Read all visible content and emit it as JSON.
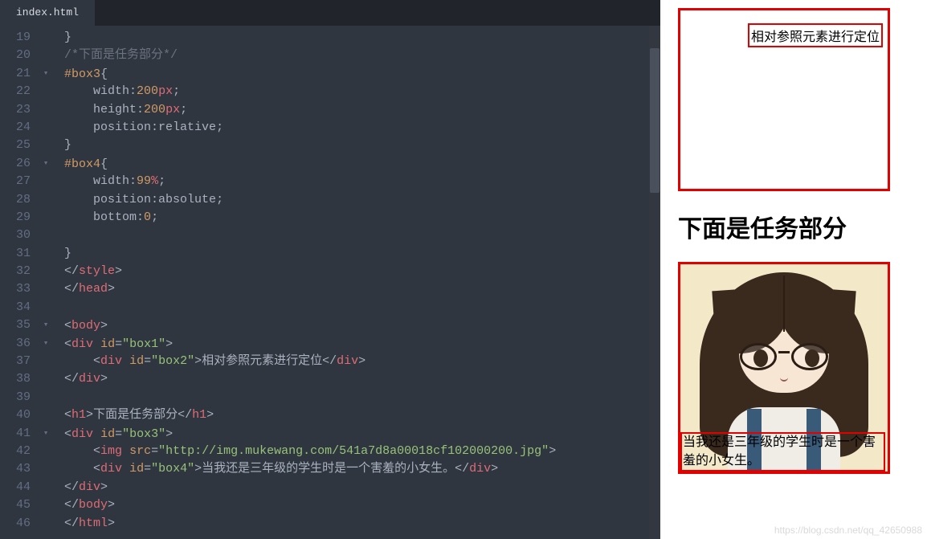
{
  "editor": {
    "tab": "index.html",
    "first_line_number": 19,
    "lines": [
      {
        "n": 19,
        "fold": "",
        "seg": [
          [
            "  ",
            "p"
          ],
          [
            "}",
            "p"
          ]
        ]
      },
      {
        "n": 20,
        "fold": "",
        "seg": [
          [
            "  ",
            "p"
          ],
          [
            "/*下面是任务部分*/",
            "comment"
          ]
        ]
      },
      {
        "n": 21,
        "fold": "v",
        "seg": [
          [
            "  ",
            "p"
          ],
          [
            "#box3",
            "sel"
          ],
          [
            "{",
            "p"
          ]
        ]
      },
      {
        "n": 22,
        "fold": "",
        "seg": [
          [
            "      ",
            "p"
          ],
          [
            "width",
            "prop"
          ],
          [
            ":",
            "p"
          ],
          [
            "200",
            "num"
          ],
          [
            "px",
            "unit"
          ],
          [
            ";",
            "p"
          ]
        ]
      },
      {
        "n": 23,
        "fold": "",
        "seg": [
          [
            "      ",
            "p"
          ],
          [
            "height",
            "prop"
          ],
          [
            ":",
            "p"
          ],
          [
            "200",
            "num"
          ],
          [
            "px",
            "unit"
          ],
          [
            ";",
            "p"
          ]
        ]
      },
      {
        "n": 24,
        "fold": "",
        "seg": [
          [
            "      ",
            "p"
          ],
          [
            "position",
            "prop"
          ],
          [
            ":",
            "p"
          ],
          [
            "relative",
            "val"
          ],
          [
            ";",
            "p"
          ]
        ]
      },
      {
        "n": 25,
        "fold": "",
        "seg": [
          [
            "  ",
            "p"
          ],
          [
            "}",
            "p"
          ]
        ]
      },
      {
        "n": 26,
        "fold": "v",
        "seg": [
          [
            "  ",
            "p"
          ],
          [
            "#box4",
            "sel"
          ],
          [
            "{",
            "p"
          ]
        ]
      },
      {
        "n": 27,
        "fold": "",
        "seg": [
          [
            "      ",
            "p"
          ],
          [
            "width",
            "prop"
          ],
          [
            ":",
            "p"
          ],
          [
            "99",
            "num"
          ],
          [
            "%",
            "unit"
          ],
          [
            ";",
            "p"
          ]
        ]
      },
      {
        "n": 28,
        "fold": "",
        "seg": [
          [
            "      ",
            "p"
          ],
          [
            "position",
            "prop"
          ],
          [
            ":",
            "p"
          ],
          [
            "absolute",
            "val"
          ],
          [
            ";",
            "p"
          ]
        ]
      },
      {
        "n": 29,
        "fold": "",
        "seg": [
          [
            "      ",
            "p"
          ],
          [
            "bottom",
            "prop"
          ],
          [
            ":",
            "p"
          ],
          [
            "0",
            "num"
          ],
          [
            ";",
            "p"
          ]
        ]
      },
      {
        "n": 30,
        "fold": "",
        "seg": [
          [
            "",
            "p"
          ]
        ]
      },
      {
        "n": 31,
        "fold": "",
        "seg": [
          [
            "  ",
            "p"
          ],
          [
            "}",
            "p"
          ]
        ]
      },
      {
        "n": 32,
        "fold": "",
        "seg": [
          [
            "  ",
            "p"
          ],
          [
            "</",
            "p"
          ],
          [
            "style",
            "tag"
          ],
          [
            ">",
            "p"
          ]
        ]
      },
      {
        "n": 33,
        "fold": "",
        "seg": [
          [
            "  ",
            "p"
          ],
          [
            "</",
            "p"
          ],
          [
            "head",
            "tag"
          ],
          [
            ">",
            "p"
          ]
        ]
      },
      {
        "n": 34,
        "fold": "",
        "seg": [
          [
            "",
            "p"
          ]
        ]
      },
      {
        "n": 35,
        "fold": "v",
        "seg": [
          [
            "  ",
            "p"
          ],
          [
            "<",
            "p"
          ],
          [
            "body",
            "tag"
          ],
          [
            ">",
            "p"
          ]
        ]
      },
      {
        "n": 36,
        "fold": "v",
        "seg": [
          [
            "  ",
            "p"
          ],
          [
            "<",
            "p"
          ],
          [
            "div",
            "tag"
          ],
          [
            " ",
            "p"
          ],
          [
            "id",
            "attr"
          ],
          [
            "=",
            "p"
          ],
          [
            "\"box1\"",
            "str"
          ],
          [
            ">",
            "p"
          ]
        ]
      },
      {
        "n": 37,
        "fold": "",
        "seg": [
          [
            "      ",
            "p"
          ],
          [
            "<",
            "p"
          ],
          [
            "div",
            "tag"
          ],
          [
            " ",
            "p"
          ],
          [
            "id",
            "attr"
          ],
          [
            "=",
            "p"
          ],
          [
            "\"box2\"",
            "str"
          ],
          [
            ">",
            "p"
          ],
          [
            "相对参照元素进行定位",
            "txt"
          ],
          [
            "</",
            "p"
          ],
          [
            "div",
            "tag"
          ],
          [
            ">",
            "p"
          ]
        ]
      },
      {
        "n": 38,
        "fold": "",
        "seg": [
          [
            "  ",
            "p"
          ],
          [
            "</",
            "p"
          ],
          [
            "div",
            "tag"
          ],
          [
            ">",
            "p"
          ]
        ]
      },
      {
        "n": 39,
        "fold": "",
        "seg": [
          [
            "",
            "p"
          ]
        ]
      },
      {
        "n": 40,
        "fold": "",
        "seg": [
          [
            "  ",
            "p"
          ],
          [
            "<",
            "p"
          ],
          [
            "h1",
            "tag"
          ],
          [
            ">",
            "p"
          ],
          [
            "下面是任务部分",
            "txt"
          ],
          [
            "</",
            "p"
          ],
          [
            "h1",
            "tag"
          ],
          [
            ">",
            "p"
          ]
        ]
      },
      {
        "n": 41,
        "fold": "v",
        "seg": [
          [
            "  ",
            "p"
          ],
          [
            "<",
            "p"
          ],
          [
            "div",
            "tag"
          ],
          [
            " ",
            "p"
          ],
          [
            "id",
            "attr"
          ],
          [
            "=",
            "p"
          ],
          [
            "\"box3\"",
            "str"
          ],
          [
            ">",
            "p"
          ]
        ]
      },
      {
        "n": 42,
        "fold": "",
        "seg": [
          [
            "      ",
            "p"
          ],
          [
            "<",
            "p"
          ],
          [
            "img",
            "tag"
          ],
          [
            " ",
            "p"
          ],
          [
            "src",
            "attr"
          ],
          [
            "=",
            "p"
          ],
          [
            "\"http://img.mukewang.com/541a7d8a00018cf102000200.jpg\"",
            "str"
          ],
          [
            ">",
            "p"
          ]
        ]
      },
      {
        "n": 43,
        "fold": "",
        "seg": [
          [
            "      ",
            "p"
          ],
          [
            "<",
            "p"
          ],
          [
            "div",
            "tag"
          ],
          [
            " ",
            "p"
          ],
          [
            "id",
            "attr"
          ],
          [
            "=",
            "p"
          ],
          [
            "\"box4\"",
            "str"
          ],
          [
            ">",
            "p"
          ],
          [
            "当我还是三年级的学生时是一个害羞的小女生。",
            "txt"
          ],
          [
            "</",
            "p"
          ],
          [
            "div",
            "tag"
          ],
          [
            ">",
            "p"
          ]
        ]
      },
      {
        "n": 44,
        "fold": "",
        "seg": [
          [
            "  ",
            "p"
          ],
          [
            "</",
            "p"
          ],
          [
            "div",
            "tag"
          ],
          [
            ">",
            "p"
          ]
        ]
      },
      {
        "n": 45,
        "fold": "",
        "seg": [
          [
            "  ",
            "p"
          ],
          [
            "</",
            "p"
          ],
          [
            "body",
            "tag"
          ],
          [
            ">",
            "p"
          ]
        ]
      },
      {
        "n": 46,
        "fold": "",
        "seg": [
          [
            "  ",
            "p"
          ],
          [
            "</",
            "p"
          ],
          [
            "html",
            "tag"
          ],
          [
            ">",
            "p"
          ]
        ]
      }
    ]
  },
  "preview": {
    "box2_text": "相对参照元素进行定位",
    "heading": "下面是任务部分",
    "box4_text": "当我还是三年级的学生时是一个害羞的小女生。",
    "watermark": "https://blog.csdn.net/qq_42650988"
  }
}
